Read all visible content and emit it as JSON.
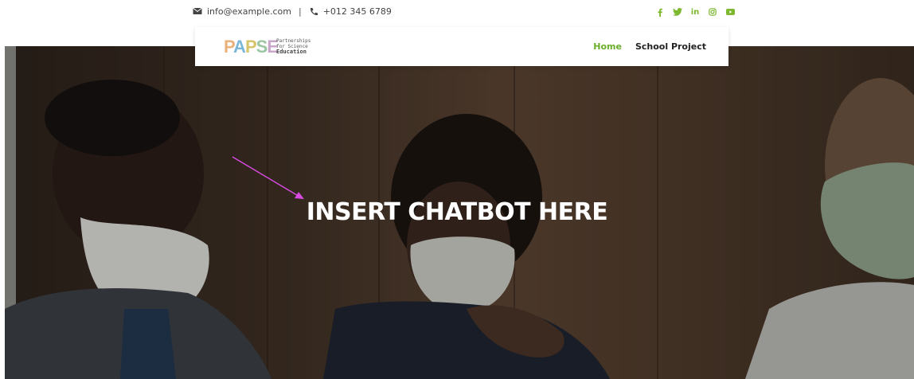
{
  "topbar": {
    "email": "info@example.com",
    "separator": "|",
    "phone": "+012 345 6789",
    "social_icons": [
      "facebook-icon",
      "twitter-icon",
      "linkedin-icon",
      "instagram-icon",
      "youtube-icon"
    ]
  },
  "navbar": {
    "logo": {
      "mark": [
        "P",
        "A",
        "P",
        "S",
        "E"
      ],
      "line1": "Partnerships",
      "line2": "for Science",
      "line3": "Education"
    },
    "items": [
      {
        "label": "Home",
        "active": true
      },
      {
        "label": "School Project",
        "active": false
      }
    ]
  },
  "hero": {
    "headline": "INSERT CHATBOT HERE"
  },
  "colors": {
    "accent": "#6aae2a",
    "social": "#7db82e",
    "arrow": "#d84be0"
  }
}
